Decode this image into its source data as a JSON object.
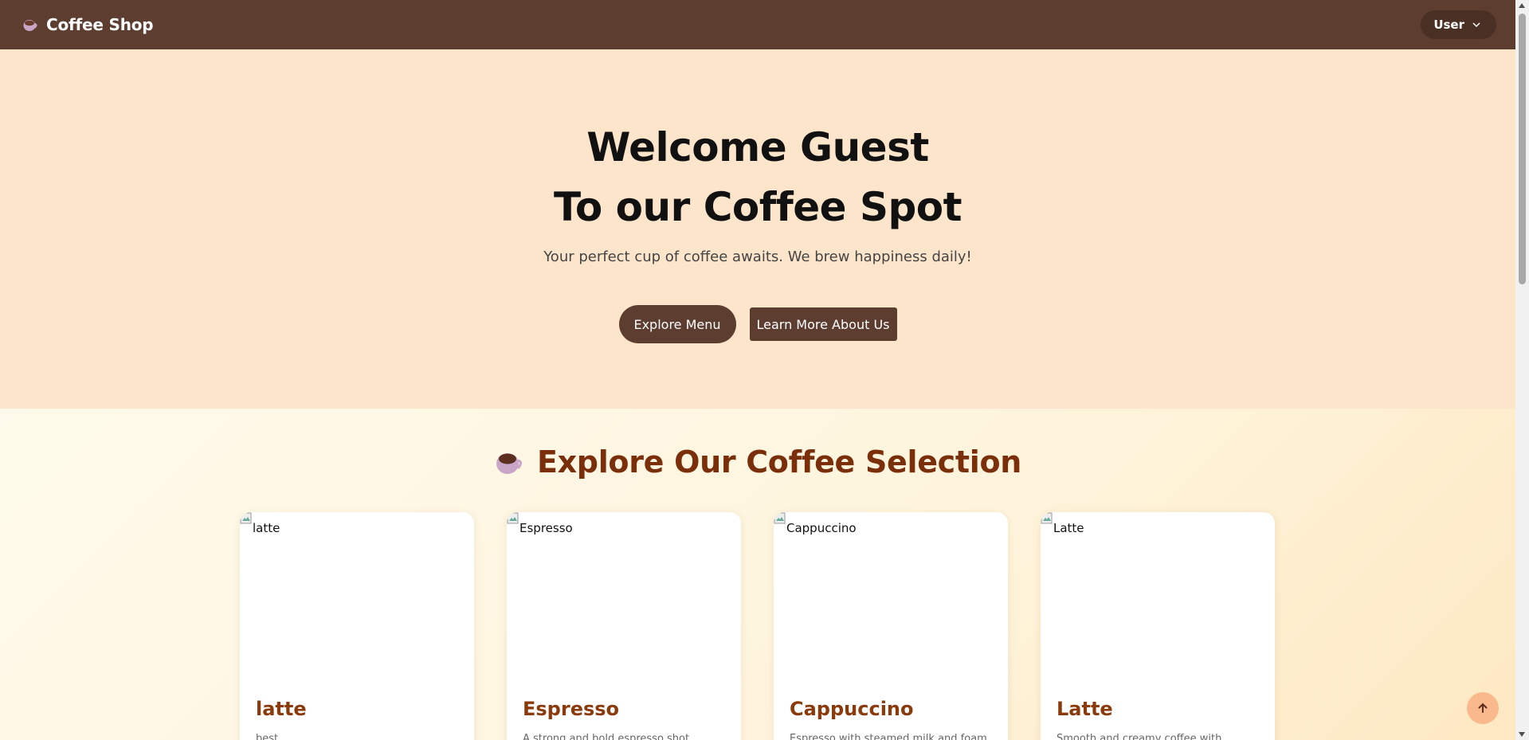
{
  "navbar": {
    "brand": "Coffee Shop",
    "brand_icon": "coffee-cup-icon",
    "user_label": "User",
    "user_icon": "chevron-down-icon"
  },
  "hero": {
    "title_line1": "Welcome Guest",
    "title_line2": "To our Coffee Spot",
    "subtitle": "Your perfect cup of coffee awaits. We brew happiness daily!",
    "explore_label": "Explore Menu",
    "learn_label": "Learn More About Us"
  },
  "section": {
    "title": "Explore Our Coffee Selection",
    "title_icon": "coffee-cup-icon"
  },
  "cards": [
    {
      "alt": "latte",
      "name": "latte",
      "desc": "best"
    },
    {
      "alt": "Espresso",
      "name": "Espresso",
      "desc": "A strong and bold espresso shot."
    },
    {
      "alt": "Cappuccino",
      "name": "Cappuccino",
      "desc": "Espresso with steamed milk and foam."
    },
    {
      "alt": "Latte",
      "name": "Latte",
      "desc": "Smooth and creamy coffee with..."
    }
  ],
  "scroll_top_icon": "arrow-up-icon",
  "colors": {
    "navbar": "#5c3d30",
    "hero_bg": "#fde5cc",
    "accent_title": "#7a2e0a",
    "card_title": "#8b3a0c",
    "scroll_top_bg": "#f9b98c"
  }
}
